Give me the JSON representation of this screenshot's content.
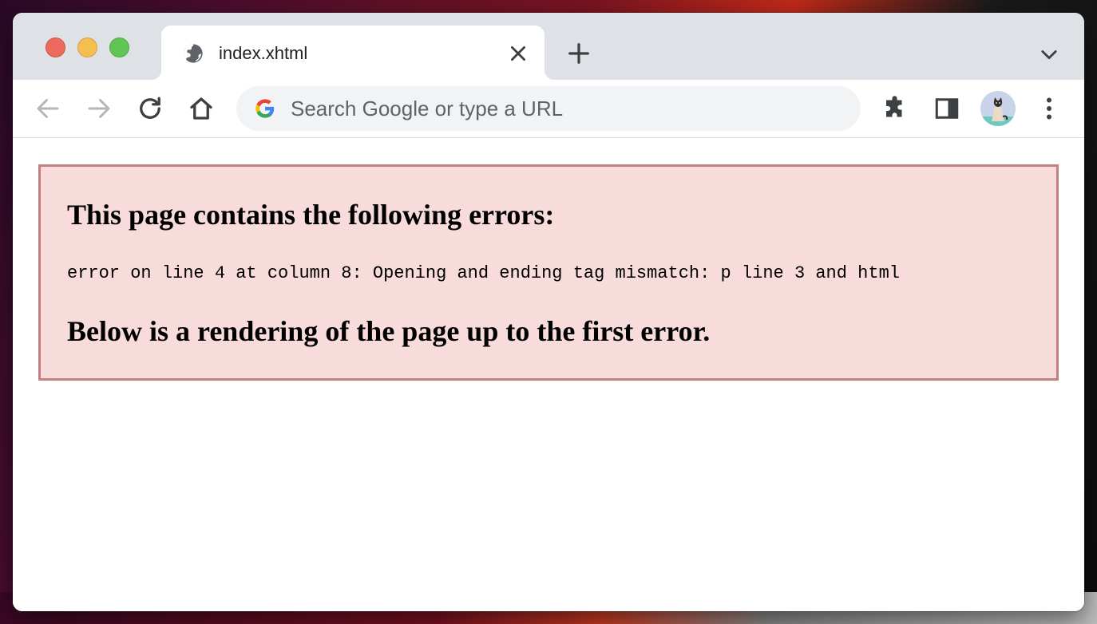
{
  "browser": {
    "tab": {
      "title": "index.xhtml",
      "favicon": "globe-icon"
    },
    "omnibox": {
      "placeholder": "Search Google or type a URL",
      "value": ""
    },
    "toolbar_icons": [
      "back-arrow-icon",
      "forward-arrow-icon",
      "reload-icon",
      "home-icon",
      "extensions-puzzle-icon",
      "side-panel-icon",
      "profile-avatar",
      "more-vert-icon"
    ],
    "colors": {
      "tabstrip": "#dee1e6",
      "toolbar": "#ffffff",
      "omnibox": "#f1f3f4"
    }
  },
  "page": {
    "error_heading": "This page contains the following errors:",
    "error_message": "error on line 4 at column 8: Opening and ending tag mismatch: p line 3 and html",
    "render_heading": "Below is a rendering of the page up to the first error.",
    "colors": {
      "error_background": "#f8dcdc",
      "error_border": "#c38080"
    }
  }
}
